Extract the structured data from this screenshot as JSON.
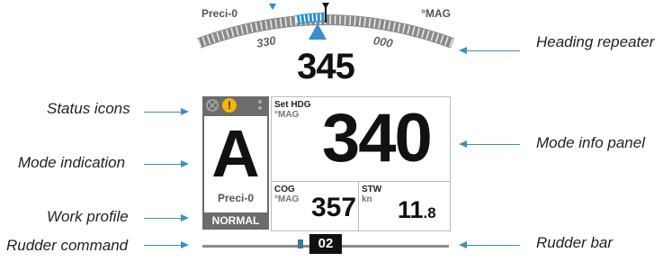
{
  "callouts": {
    "status_icons": "Status icons",
    "mode_indication": "Mode indication",
    "work_profile": "Work profile",
    "rudder_command": "Rudder command",
    "heading_repeater": "Heading repeater",
    "mode_info_panel": "Mode info panel",
    "rudder_bar": "Rudder bar"
  },
  "compass": {
    "profile": "Preci-0",
    "reference": "°MAG",
    "tick_left": "330",
    "tick_right": "000",
    "heading": "345"
  },
  "status": {
    "warning_icon": "warning-icon",
    "warning_glyph": "!"
  },
  "mode": {
    "letter": "A",
    "work_profile": "Preci-0",
    "state": "NORMAL"
  },
  "info": {
    "set_hdg_label": "Set HDG",
    "set_hdg_unit": "°MAG",
    "set_hdg_value": "340",
    "cog_label": "COG",
    "cog_unit": "°MAG",
    "cog_value": "357",
    "stw_label": "STW",
    "stw_unit": "kn",
    "stw_value_int": "11",
    "stw_value_dec": ".8"
  },
  "rudder": {
    "command": "02"
  },
  "colors": {
    "accent": "#3f8fbf",
    "panel_gray": "#6c6c6c",
    "warning": "#f5b800"
  }
}
